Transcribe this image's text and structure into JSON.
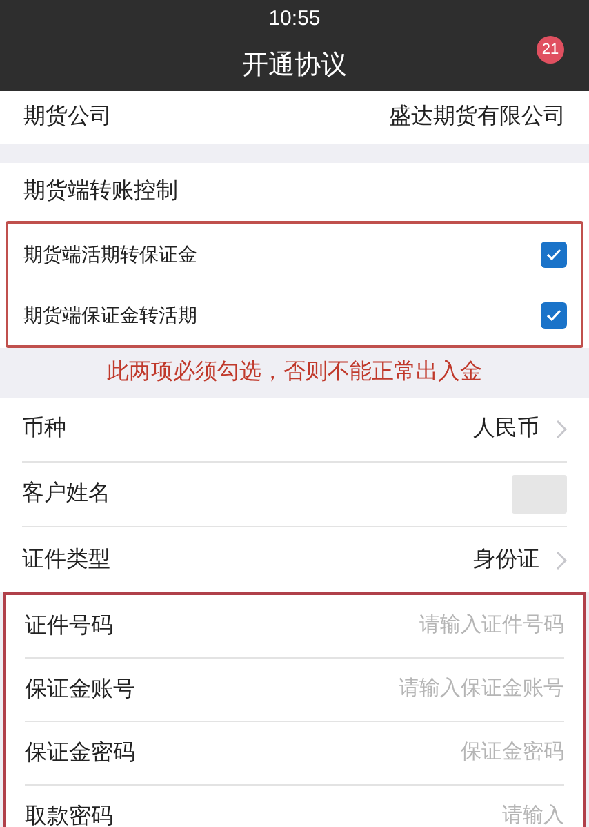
{
  "status_bar": {
    "time": "10:55"
  },
  "nav": {
    "title": "开通协议",
    "badge": "21"
  },
  "company": {
    "label": "期货公司",
    "value": "盛达期货有限公司"
  },
  "transfer": {
    "title": "期货端转账控制",
    "options": [
      {
        "label": "期货端活期转保证金",
        "checked": true
      },
      {
        "label": "期货端保证金转活期",
        "checked": true
      }
    ],
    "note": "此两项必须勾选，否则不能正常出入金"
  },
  "rows": [
    {
      "kind": "select",
      "label": "币种",
      "value": "人民币"
    },
    {
      "kind": "hidden",
      "label": "客户姓名"
    },
    {
      "kind": "select",
      "label": "证件类型",
      "value": "身份证"
    }
  ],
  "inputs": [
    {
      "label": "证件号码",
      "placeholder": "请输入证件号码"
    },
    {
      "label": "保证金账号",
      "placeholder": "请输入保证金账号"
    },
    {
      "label": "保证金密码",
      "placeholder": "保证金密码"
    },
    {
      "label": "取款密码",
      "placeholder": "请输入"
    }
  ]
}
